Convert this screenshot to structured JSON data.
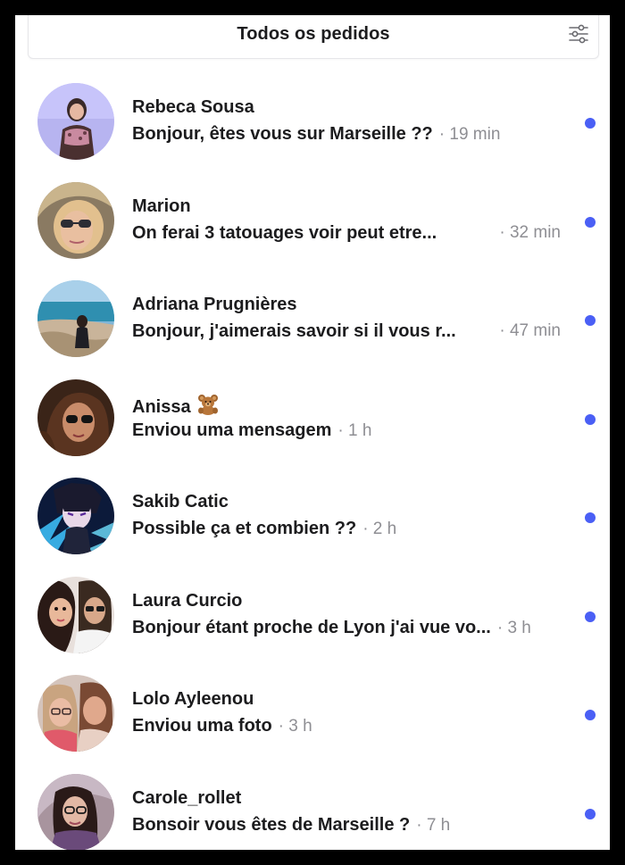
{
  "header": {
    "title": "Todos os pedidos",
    "filter_icon": "sliders-icon"
  },
  "colors": {
    "unread_dot": "#4a5ff5",
    "text_primary": "#1c1c1e",
    "text_secondary": "#8e8e93"
  },
  "requests": [
    {
      "name": "Rebeca Sousa",
      "message": "Bonjour, êtes vous sur Marseille ??",
      "time": "· 19 min",
      "unread": true,
      "emoji": ""
    },
    {
      "name": "Marion",
      "message": "On ferai 3 tatouages voir peut etre...",
      "time": "· 32 min",
      "unread": true,
      "emoji": ""
    },
    {
      "name": "Adriana Prugnières",
      "message": "Bonjour, j'aimerais savoir si il vous r...",
      "time": "· 47 min",
      "unread": true,
      "emoji": ""
    },
    {
      "name": "Anissa",
      "message": "Enviou uma mensagem",
      "time": "· 1 h",
      "unread": true,
      "emoji": "teddy-bear-icon"
    },
    {
      "name": "Sakib Catic",
      "message": "Possible ça et combien ??",
      "time": "· 2 h",
      "unread": true,
      "emoji": ""
    },
    {
      "name": "Laura Curcio",
      "message": "Bonjour étant proche de Lyon j'ai vue vo...",
      "time": "· 3 h",
      "unread": true,
      "emoji": ""
    },
    {
      "name": "Lolo Ayleenou",
      "message": "Enviou uma foto",
      "time": "· 3 h",
      "unread": true,
      "emoji": ""
    },
    {
      "name": "Carole_rollet",
      "message": "Bonsoir vous êtes de Marseille ?",
      "time": "· 7 h",
      "unread": true,
      "emoji": ""
    }
  ]
}
